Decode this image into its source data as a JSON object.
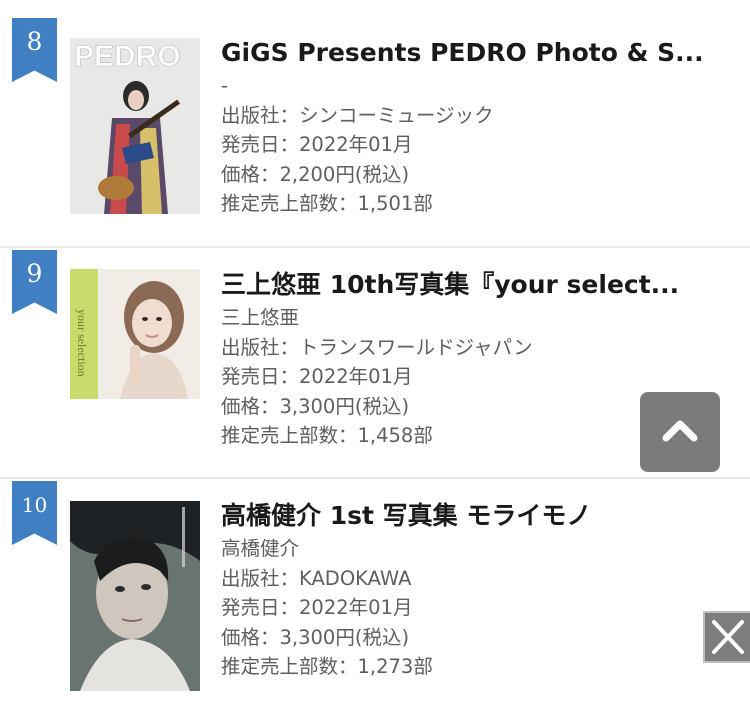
{
  "colors": {
    "rank_badge": "#3f7fc2",
    "title": "#1a1a1a",
    "meta": "#5f5f5f",
    "divider": "#e8e8e8"
  },
  "labels": {
    "publisher": "出版社：",
    "release": "発売日：",
    "price": "価格：",
    "sales": "推定売上部数："
  },
  "items": [
    {
      "rank": "8",
      "title": "GiGS Presents PEDRO Photo & S...",
      "author": "-",
      "publisher": "シンコーミュージック",
      "release": "2022年01月",
      "price": "2,200円(税込)",
      "sales": "1,501部",
      "cover_text": "PEDRO"
    },
    {
      "rank": "9",
      "title": "三上悠亜 10th写真集『your select...",
      "author": "三上悠亜",
      "publisher": "トランスワールドジャパン",
      "release": "2022年01月",
      "price": "3,300円(税込)",
      "sales": "1,458部",
      "cover_text": "your selection"
    },
    {
      "rank": "10",
      "title": "高橋健介 1st 写真集 モライモノ",
      "author": "高橋健介",
      "publisher": "KADOKAWA",
      "release": "2022年01月",
      "price": "3,300円(税込)",
      "sales": "1,273部"
    }
  ],
  "controls": {
    "scroll_top_icon": "chevron-up-icon",
    "close_icon": "close-icon"
  }
}
